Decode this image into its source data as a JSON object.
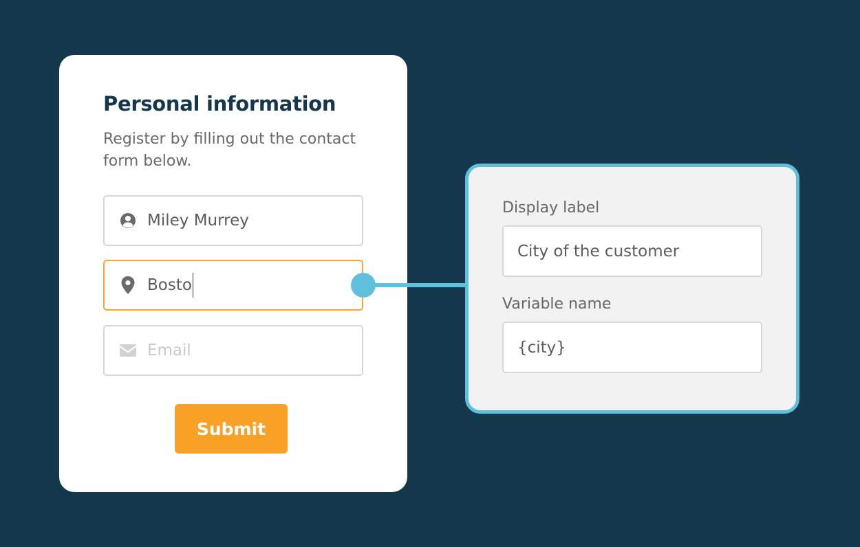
{
  "form": {
    "title": "Personal information",
    "subtitle": "Register by filling out the contact form below.",
    "fields": [
      {
        "icon": "user-circle-icon",
        "value": "Miley Murrey",
        "state": "filled"
      },
      {
        "icon": "map-marker-icon",
        "value": "Bosto",
        "state": "focused"
      },
      {
        "icon": "envelope-icon",
        "placeholder": "Email",
        "state": "empty"
      }
    ],
    "submit_label": "Submit"
  },
  "panel": {
    "display_label_title": "Display label",
    "display_label_value": "City of the customer",
    "variable_name_title": "Variable name",
    "variable_name_value": "{city}"
  },
  "colors": {
    "background": "#15374b",
    "accent_orange": "#f9a126",
    "focus_border": "#f6a730",
    "connector_blue": "#5ec0dc",
    "title_text": "#15374b"
  }
}
